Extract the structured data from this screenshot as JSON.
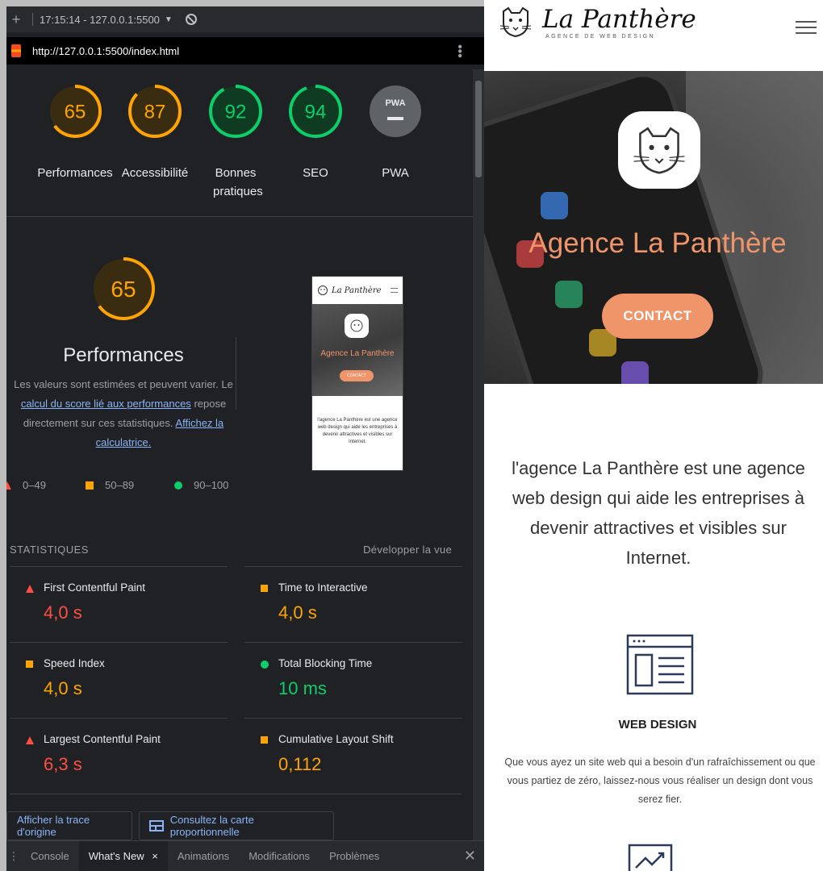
{
  "devtools": {
    "topbar": {
      "plus": "+",
      "session": "17:15:14 - 127.0.0.1:5500",
      "caret": "▼"
    },
    "url": "http://127.0.0.1:5500/index.html",
    "gauges": [
      {
        "score": "65",
        "label": "Performances",
        "value": 65,
        "color": "#ffa400"
      },
      {
        "score": "87",
        "label": "Accessibilité",
        "value": 87,
        "color": "#ffa400"
      },
      {
        "score": "92",
        "label": "Bonnes pratiques",
        "value": 92,
        "color": "#0cce6b"
      },
      {
        "score": "94",
        "label": "SEO",
        "value": 94,
        "color": "#0cce6b"
      },
      {
        "score": "PWA",
        "label": "PWA",
        "value": 0,
        "color": "#9aa0a6"
      }
    ],
    "perf": {
      "score": "65",
      "value": 65,
      "title": "Performances",
      "desc_prefix": "Les valeurs sont estimées et peuvent varier. Le",
      "link1": "calcul du score lié aux performances",
      "desc_mid": "repose directement sur ces statistiques.",
      "link2": "Affichez la calculatrice."
    },
    "legend": {
      "low": "0–49",
      "mid": "50–89",
      "high": "90–100"
    },
    "thumbnail": {
      "brand": "La Panthère",
      "hero_title": "Agence La Panthère",
      "button": "CONTACT",
      "text": "l'agence La Panthère est une agence web design qui aide les entreprises à devenir attractives et visibles sur Internet."
    },
    "stats": {
      "heading": "STATISTIQUES",
      "expand": "Développer la vue",
      "metrics": [
        {
          "name": "First Contentful Paint",
          "value": "4,0 s",
          "status": "red"
        },
        {
          "name": "Time to Interactive",
          "value": "4,0 s",
          "status": "orange"
        },
        {
          "name": "Speed Index",
          "value": "4,0 s",
          "status": "orange"
        },
        {
          "name": "Total Blocking Time",
          "value": "10 ms",
          "status": "green"
        },
        {
          "name": "Largest Contentful Paint",
          "value": "6,3 s",
          "status": "red"
        },
        {
          "name": "Cumulative Layout Shift",
          "value": "0,112",
          "status": "orange"
        }
      ]
    },
    "buttons": {
      "trace": "Afficher la trace d'origine",
      "treemap": "Consultez la carte proportionnelle"
    },
    "drawer": {
      "tabs": [
        "Console",
        "What's New",
        "Animations",
        "Modifications",
        "Problèmes"
      ],
      "active_close": "×",
      "close": "✕"
    }
  },
  "site": {
    "brand": "La Panthère",
    "brand_sub": "AGENCE DE WEB DESIGN",
    "hero_title": "Agence La Panthère",
    "hero_button": "CONTACT",
    "intro": "l'agence La Panthère est une agence web design qui aide les entreprises à devenir attractives et visibles sur Internet.",
    "service_title": "WEB DESIGN",
    "service_desc": "Que vous ayez un site web qui a besoin d'un rafraîchissement ou que vous partiez de zéro, laissez-nous vous réaliser un design dont vous serez fier.",
    "accent": "#f0956a"
  }
}
